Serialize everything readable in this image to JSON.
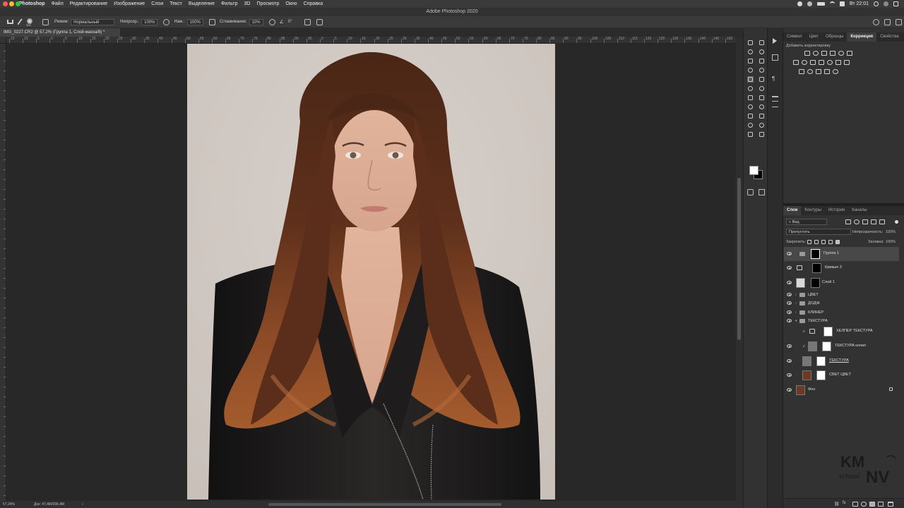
{
  "menubar": {
    "app_name": "Photoshop",
    "items": [
      "Файл",
      "Редактирование",
      "Изображение",
      "Слои",
      "Текст",
      "Выделение",
      "Фильтр",
      "3D",
      "Просмотр",
      "Окно",
      "Справка"
    ],
    "clock": "Вт 22:01"
  },
  "window_title": "Adobe Photoshop 2020",
  "options_bar": {
    "brush_size": "200",
    "mode_label": "Режим:",
    "mode_value": "Нормальный",
    "opacity_label": "Непрозр.:",
    "opacity_value": "100%",
    "pressure_label": "Наж.:",
    "pressure_value": "100%",
    "smoothing_label": "Сглаживание:",
    "smoothing_value": "10%",
    "angle_value": "0°"
  },
  "document_tab": "IMG_0227.CR2 @ 57,2% (Группа 1, Слой-маска/8) *",
  "rulers": {
    "horizontal_ticks": [
      "15",
      "10",
      "5",
      "0",
      "5",
      "10",
      "15",
      "20",
      "25",
      "30",
      "35",
      "40",
      "45",
      "50",
      "55",
      "60",
      "65",
      "70",
      "75",
      "80",
      "85",
      "90",
      "95",
      "0",
      "5",
      "10",
      "15",
      "20",
      "25",
      "30",
      "35",
      "40",
      "45",
      "50",
      "55",
      "60",
      "65",
      "70",
      "75",
      "80",
      "85",
      "90",
      "95",
      "100",
      "105",
      "110",
      "115",
      "120",
      "125",
      "130",
      "135",
      "140",
      "145",
      "150"
    ]
  },
  "status_bar": {
    "zoom": "57,24%",
    "doc_info": "Док: 47,4M/396,4M"
  },
  "panels_top": {
    "tabs": [
      "Символ",
      "Цвет",
      "Образцы",
      "Коррекция",
      "Свойства"
    ],
    "active_tab": "Коррекция",
    "hint": "Добавить корректировку"
  },
  "panels_layers": {
    "tabs": [
      "Слои",
      "Контуры",
      "История",
      "Каналы"
    ],
    "active_tab": "Слои",
    "filter_kind": "Вид",
    "blend_mode": "Пропустить",
    "opacity_label": "Непрозрачность:",
    "opacity_value": "100%",
    "lock_label": "Закрепить:",
    "fill_label": "Заливка:",
    "fill_value": "100%",
    "layers": [
      {
        "name": "Группа 1",
        "type": "group-mask",
        "selected": true
      },
      {
        "name": "Кривые 3",
        "type": "curves"
      },
      {
        "name": "Слой 1",
        "type": "layer"
      },
      {
        "name": "ЦВЕТ",
        "type": "folder"
      },
      {
        "name": "ДОДЖ",
        "type": "folder"
      },
      {
        "name": "КЛИНЕР",
        "type": "folder"
      },
      {
        "name": "ТЕКСТУРА",
        "type": "folder-open"
      },
      {
        "name": "ХЕЛПЕР ТЕКСТУРА",
        "type": "adjust",
        "hidden": true
      },
      {
        "name": "ТЕКСТУРА копия",
        "type": "layer-clip"
      },
      {
        "name": "ТЕКСТУРА",
        "type": "layer-mask"
      },
      {
        "name": "СВЕТ ЦВЕТ",
        "type": "photo-mask"
      },
      {
        "name": "Фон",
        "type": "background"
      }
    ]
  },
  "watermark": {
    "top": "KM",
    "bottom": "NV",
    "script": "school"
  },
  "colors": {
    "menubar_bg": "#3a3a3a",
    "panel_bg": "#323232",
    "canvas_bg": "#282828",
    "backdrop": "#d1c9c3",
    "hair": "#6b3a22",
    "jacket": "#1c1a1a"
  }
}
